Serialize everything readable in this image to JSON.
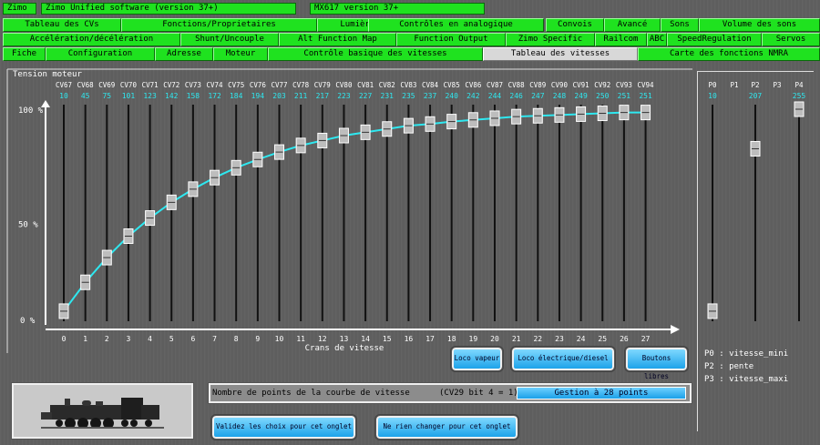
{
  "top_bar": {
    "brand": "Zimo",
    "software": "Zimo Unified software (version 37+)",
    "decoder": "MX617 version 37+"
  },
  "tabs_row1": [
    "Tableau des CVs",
    "Fonctions/Proprietaires",
    "Lumières",
    "Contrôles en analogique",
    "Convois",
    "Avancé",
    "Sons",
    "Volume des sons"
  ],
  "tabs_row2": [
    "Accélération/décélération",
    "Shunt/Uncouple",
    "Alt Function Map",
    "Function Output",
    "Zimo Specific",
    "Railcom",
    "ABC",
    "SpeedRegulation",
    "Servos"
  ],
  "tabs_row3": [
    "Fiche",
    "Configuration",
    "Adresse",
    "Moteur",
    "Contrôle basique des vitesses",
    "Tableau des vitesses",
    "Carte des fonctions NMRA"
  ],
  "active_tab": "Tableau des vitesses",
  "chart_data": {
    "type": "line",
    "title": "",
    "ylabel": "Tension moteur",
    "xlabel": "Crans de vitesse",
    "y_ticks": [
      "100 %",
      "50 %",
      "0 %"
    ],
    "ylim": [
      0,
      255
    ],
    "x": [
      0,
      1,
      2,
      3,
      4,
      5,
      6,
      7,
      8,
      9,
      10,
      11,
      12,
      13,
      14,
      15,
      16,
      17,
      18,
      19,
      20,
      21,
      22,
      23,
      24,
      25,
      26,
      27
    ],
    "cv_labels": [
      "CV67",
      "CV68",
      "CV69",
      "CV70",
      "CV71",
      "CV72",
      "CV73",
      "CV74",
      "CV75",
      "CV76",
      "CV77",
      "CV78",
      "CV79",
      "CV80",
      "CV81",
      "CV82",
      "CV83",
      "CV84",
      "CV85",
      "CV86",
      "CV87",
      "CV88",
      "CV89",
      "CV90",
      "CV91",
      "CV92",
      "CV93",
      "CV94"
    ],
    "values": [
      10,
      45,
      75,
      101,
      123,
      142,
      158,
      172,
      184,
      194,
      203,
      211,
      217,
      223,
      227,
      231,
      235,
      237,
      240,
      242,
      244,
      246,
      247,
      248,
      249,
      250,
      251,
      251
    ],
    "line_color": "#2ee8f0",
    "value_color": "#2ee8f0"
  },
  "params": {
    "labels": [
      "P0",
      "P1",
      "P2",
      "P3",
      "P4"
    ],
    "values": [
      "10",
      "",
      "207",
      "",
      "255"
    ],
    "legend": [
      "P0 : vitesse_mini",
      "P2 : pente",
      "P3 : vitesse_maxi"
    ]
  },
  "buttons": {
    "steam": "Loco vapeur",
    "electric": "Loco électrique/diesel",
    "free": "Boutons libres",
    "validate": "Validez les choix pour cet onglet",
    "cancel": "Ne rien changer pour cet onglet"
  },
  "curve_points": {
    "label": "Nombre de points de la courbe de vitesse",
    "note": "(CV29 bit 4 = 1)",
    "value": "Gestion à 28 points"
  }
}
